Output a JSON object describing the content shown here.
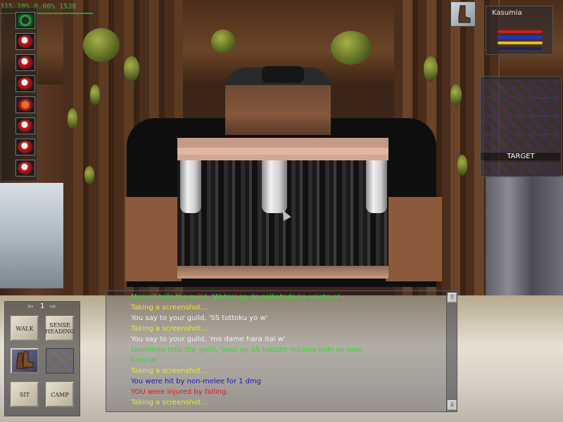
{
  "status": {
    "text": "315   28%  0.00%  1538"
  },
  "player": {
    "name": "Kasumia"
  },
  "target": {
    "label": "TARGET"
  },
  "hotbar": {
    "page": "1",
    "prev_icon": "⇦",
    "next_icon": "⇨",
    "buttons": {
      "walk": "WALK",
      "sense_heading": "SENSE HEADING",
      "sit": "SIT",
      "camp": "CAMP"
    }
  },
  "chat": {
    "lines": [
      {
        "text": "Morvell tells the guild, 'Watasi ga de nalkatada ka usiete w'",
        "color": "#3ed23a"
      },
      {
        "text": "Taking a screenshot...",
        "color": "#e8e83a"
      },
      {
        "text": "You say to your guild, 'SS tottoku yo w'",
        "color": "#f2f2f2"
      },
      {
        "text": "Taking a screenshot...",
        "color": "#e8e83a"
      },
      {
        "text": "You say to your guild, 'mo dame hara itai w'",
        "color": "#f2f2f2"
      },
      {
        "text": "Diamante tells the guild, 'wasi ga SS tukatte mitaina hahi do nule",
        "color": "#3ed23a"
      },
      {
        "text": "kana w'",
        "color": "#3ed23a"
      },
      {
        "text": "Taking a screenshot...",
        "color": "#e8e83a"
      },
      {
        "text": "You were hit by non-melee for 1 dmg",
        "color": "#1a1aa8"
      },
      {
        "text": "YOU were injured by falling.",
        "color": "#d21d1d"
      },
      {
        "text": "Taking a screenshot...",
        "color": "#e8e83a"
      }
    ],
    "scroll_up_icon": "⇧",
    "scroll_down_icon": "⇩"
  },
  "colors": {
    "hp": "#c82020",
    "mana": "#2233cc",
    "stamina": "#e0c020",
    "status_green": "#3fb54b"
  }
}
